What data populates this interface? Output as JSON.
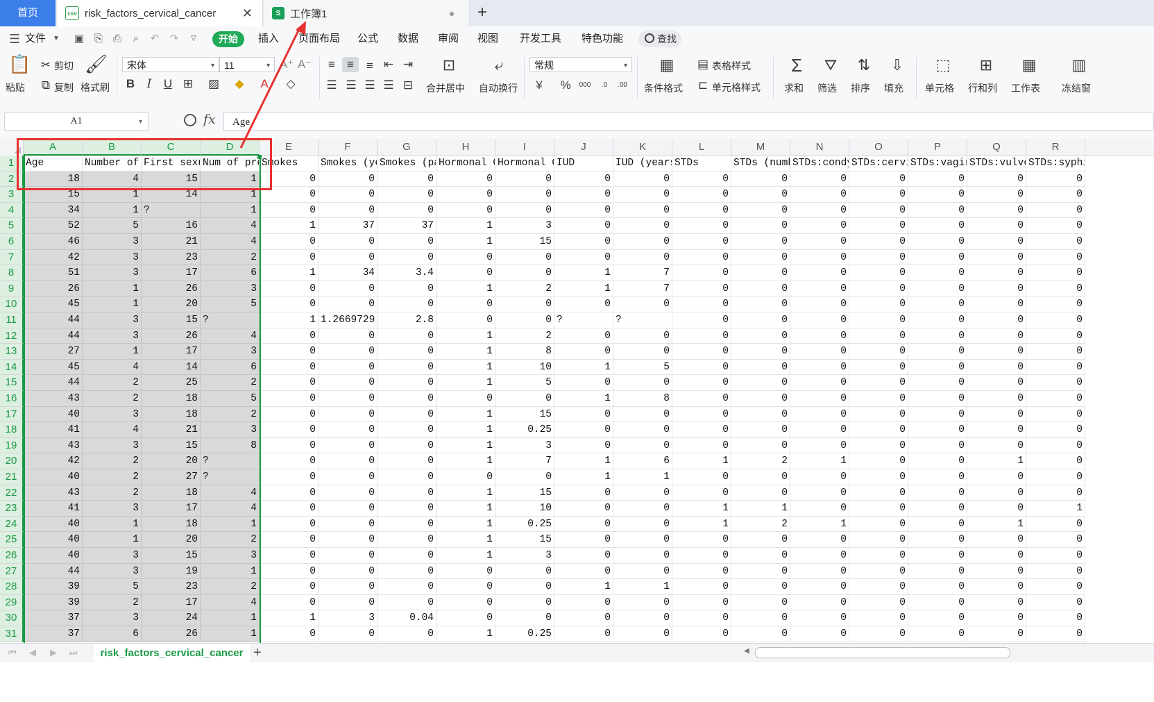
{
  "tabs": {
    "home": "首页",
    "file_tab": "risk_factors_cervical_cancer",
    "file_icon": "csv",
    "workbook_tab": "工作簿1",
    "workbook_icon": "S",
    "add": "+"
  },
  "menu": {
    "file": "文件",
    "start": "开始",
    "items": [
      "插入",
      "页面布局",
      "公式",
      "数据",
      "审阅",
      "视图",
      "开发工具",
      "特色功能"
    ],
    "search": "查找"
  },
  "ribbon": {
    "paste": "粘贴",
    "cut": "剪切",
    "copy": "复制",
    "format_painter": "格式刷",
    "font_name": "宋体",
    "font_size": "11",
    "merge_center": "合并居中",
    "wrap_text": "自动换行",
    "number_format": "常规",
    "conditional_format": "条件格式",
    "table_style": "表格样式",
    "cell_style": "单元格样式",
    "sum": "求和",
    "filter": "筛选",
    "sort": "排序",
    "fill": "填充",
    "cells": "单元格",
    "rows_cols": "行和列",
    "worksheet": "工作表",
    "freeze": "冻结窗",
    "currency_symbol": "¥",
    "percent": "%"
  },
  "formula_bar": {
    "name_box": "A1",
    "fx": "fx",
    "content": "Age"
  },
  "grid": {
    "columns": [
      "A",
      "B",
      "C",
      "D",
      "E",
      "F",
      "G",
      "H",
      "I",
      "J",
      "K",
      "L",
      "M",
      "N",
      "O",
      "P",
      "Q",
      "R"
    ],
    "header_row": [
      "Age",
      "Number of",
      "First sexu",
      "Num of pre",
      "Smokes",
      "Smokes (ye",
      "Smokes (pa",
      "Hormonal C",
      "Hormonal C",
      "IUD",
      "IUD (years",
      "STDs",
      "STDs (numb",
      "STDs:condy",
      "STDs:cervi",
      "STDs:vagir",
      "STDs:vulvo",
      "STDs:syphi"
    ],
    "rows": [
      [
        "18",
        "4",
        "15",
        "1",
        "0",
        "0",
        "0",
        "0",
        "0",
        "0",
        "0",
        "0",
        "0",
        "0",
        "0",
        "0",
        "0",
        "0"
      ],
      [
        "15",
        "1",
        "14",
        "1",
        "0",
        "0",
        "0",
        "0",
        "0",
        "0",
        "0",
        "0",
        "0",
        "0",
        "0",
        "0",
        "0",
        "0"
      ],
      [
        "34",
        "1",
        "?",
        "1",
        "0",
        "0",
        "0",
        "0",
        "0",
        "0",
        "0",
        "0",
        "0",
        "0",
        "0",
        "0",
        "0",
        "0"
      ],
      [
        "52",
        "5",
        "16",
        "4",
        "1",
        "37",
        "37",
        "1",
        "3",
        "0",
        "0",
        "0",
        "0",
        "0",
        "0",
        "0",
        "0",
        "0"
      ],
      [
        "46",
        "3",
        "21",
        "4",
        "0",
        "0",
        "0",
        "1",
        "15",
        "0",
        "0",
        "0",
        "0",
        "0",
        "0",
        "0",
        "0",
        "0"
      ],
      [
        "42",
        "3",
        "23",
        "2",
        "0",
        "0",
        "0",
        "0",
        "0",
        "0",
        "0",
        "0",
        "0",
        "0",
        "0",
        "0",
        "0",
        "0"
      ],
      [
        "51",
        "3",
        "17",
        "6",
        "1",
        "34",
        "3.4",
        "0",
        "0",
        "1",
        "7",
        "0",
        "0",
        "0",
        "0",
        "0",
        "0",
        "0"
      ],
      [
        "26",
        "1",
        "26",
        "3",
        "0",
        "0",
        "0",
        "1",
        "2",
        "1",
        "7",
        "0",
        "0",
        "0",
        "0",
        "0",
        "0",
        "0"
      ],
      [
        "45",
        "1",
        "20",
        "5",
        "0",
        "0",
        "0",
        "0",
        "0",
        "0",
        "0",
        "0",
        "0",
        "0",
        "0",
        "0",
        "0",
        "0"
      ],
      [
        "44",
        "3",
        "15",
        "?",
        "1",
        "1.2669729",
        "2.8",
        "0",
        "0",
        "?",
        "?",
        "0",
        "0",
        "0",
        "0",
        "0",
        "0",
        "0"
      ],
      [
        "44",
        "3",
        "26",
        "4",
        "0",
        "0",
        "0",
        "1",
        "2",
        "0",
        "0",
        "0",
        "0",
        "0",
        "0",
        "0",
        "0",
        "0"
      ],
      [
        "27",
        "1",
        "17",
        "3",
        "0",
        "0",
        "0",
        "1",
        "8",
        "0",
        "0",
        "0",
        "0",
        "0",
        "0",
        "0",
        "0",
        "0"
      ],
      [
        "45",
        "4",
        "14",
        "6",
        "0",
        "0",
        "0",
        "1",
        "10",
        "1",
        "5",
        "0",
        "0",
        "0",
        "0",
        "0",
        "0",
        "0"
      ],
      [
        "44",
        "2",
        "25",
        "2",
        "0",
        "0",
        "0",
        "1",
        "5",
        "0",
        "0",
        "0",
        "0",
        "0",
        "0",
        "0",
        "0",
        "0"
      ],
      [
        "43",
        "2",
        "18",
        "5",
        "0",
        "0",
        "0",
        "0",
        "0",
        "1",
        "8",
        "0",
        "0",
        "0",
        "0",
        "0",
        "0",
        "0"
      ],
      [
        "40",
        "3",
        "18",
        "2",
        "0",
        "0",
        "0",
        "1",
        "15",
        "0",
        "0",
        "0",
        "0",
        "0",
        "0",
        "0",
        "0",
        "0"
      ],
      [
        "41",
        "4",
        "21",
        "3",
        "0",
        "0",
        "0",
        "1",
        "0.25",
        "0",
        "0",
        "0",
        "0",
        "0",
        "0",
        "0",
        "0",
        "0"
      ],
      [
        "43",
        "3",
        "15",
        "8",
        "0",
        "0",
        "0",
        "1",
        "3",
        "0",
        "0",
        "0",
        "0",
        "0",
        "0",
        "0",
        "0",
        "0"
      ],
      [
        "42",
        "2",
        "20",
        "?",
        "0",
        "0",
        "0",
        "1",
        "7",
        "1",
        "6",
        "1",
        "2",
        "1",
        "0",
        "0",
        "1",
        "0"
      ],
      [
        "40",
        "2",
        "27",
        "?",
        "0",
        "0",
        "0",
        "0",
        "0",
        "1",
        "1",
        "0",
        "0",
        "0",
        "0",
        "0",
        "0",
        "0"
      ],
      [
        "43",
        "2",
        "18",
        "4",
        "0",
        "0",
        "0",
        "1",
        "15",
        "0",
        "0",
        "0",
        "0",
        "0",
        "0",
        "0",
        "0",
        "0"
      ],
      [
        "41",
        "3",
        "17",
        "4",
        "0",
        "0",
        "0",
        "1",
        "10",
        "0",
        "0",
        "1",
        "1",
        "0",
        "0",
        "0",
        "0",
        "1"
      ],
      [
        "40",
        "1",
        "18",
        "1",
        "0",
        "0",
        "0",
        "1",
        "0.25",
        "0",
        "0",
        "1",
        "2",
        "1",
        "0",
        "0",
        "1",
        "0"
      ],
      [
        "40",
        "1",
        "20",
        "2",
        "0",
        "0",
        "0",
        "1",
        "15",
        "0",
        "0",
        "0",
        "0",
        "0",
        "0",
        "0",
        "0",
        "0"
      ],
      [
        "40",
        "3",
        "15",
        "3",
        "0",
        "0",
        "0",
        "1",
        "3",
        "0",
        "0",
        "0",
        "0",
        "0",
        "0",
        "0",
        "0",
        "0"
      ],
      [
        "44",
        "3",
        "19",
        "1",
        "0",
        "0",
        "0",
        "0",
        "0",
        "0",
        "0",
        "0",
        "0",
        "0",
        "0",
        "0",
        "0",
        "0"
      ],
      [
        "39",
        "5",
        "23",
        "2",
        "0",
        "0",
        "0",
        "0",
        "0",
        "1",
        "1",
        "0",
        "0",
        "0",
        "0",
        "0",
        "0",
        "0"
      ],
      [
        "39",
        "2",
        "17",
        "4",
        "0",
        "0",
        "0",
        "0",
        "0",
        "0",
        "0",
        "0",
        "0",
        "0",
        "0",
        "0",
        "0",
        "0"
      ],
      [
        "37",
        "3",
        "24",
        "1",
        "1",
        "3",
        "0.04",
        "0",
        "0",
        "0",
        "0",
        "0",
        "0",
        "0",
        "0",
        "0",
        "0",
        "0"
      ],
      [
        "37",
        "6",
        "26",
        "1",
        "0",
        "0",
        "0",
        "1",
        "0.25",
        "0",
        "0",
        "0",
        "0",
        "0",
        "0",
        "0",
        "0",
        "0"
      ]
    ]
  },
  "sheets": {
    "active": "risk_factors_cervical_cancer",
    "add": "+"
  },
  "colors": {
    "accent_green": "#1a9a45",
    "home_blue": "#3b7de9",
    "annotation_red": "#e8312f"
  }
}
